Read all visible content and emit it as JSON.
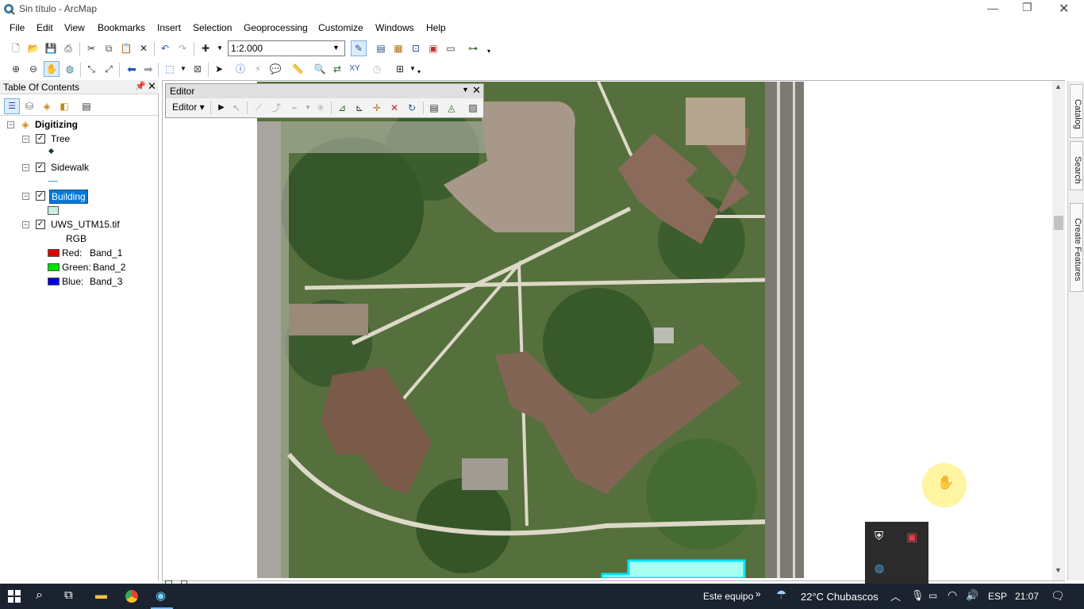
{
  "window": {
    "title": "Sin título - ArcMap"
  },
  "menu": [
    "File",
    "Edit",
    "View",
    "Bookmarks",
    "Insert",
    "Selection",
    "Geoprocessing",
    "Customize",
    "Windows",
    "Help"
  ],
  "toolbar": {
    "scale": "1:2.000"
  },
  "toc": {
    "title": "Table Of Contents",
    "group": "Digitizing",
    "layers": [
      {
        "name": "Tree",
        "checked": true
      },
      {
        "name": "Sidewalk",
        "checked": true
      },
      {
        "name": "Building",
        "checked": true,
        "selected": true
      },
      {
        "name": "UWS_UTM15.tif",
        "checked": true
      }
    ],
    "raster_composite": "RGB",
    "bands": [
      {
        "channel": "Red:",
        "band": "Band_1",
        "color": "#e00000"
      },
      {
        "channel": "Green:",
        "band": "Band_2",
        "color": "#00e000"
      },
      {
        "channel": "Blue:",
        "band": "Band_3",
        "color": "#0000e0"
      }
    ],
    "building_fill": "#c8f0e6"
  },
  "editor": {
    "title": "Editor",
    "menu_label": "Editor ▾"
  },
  "dock": {
    "catalog": "Catalog",
    "search": "Search",
    "create_features": "Create Features"
  },
  "taskbar": {
    "location": "Este equipo",
    "weather": "22°C  Chubascos",
    "lang": "ESP",
    "time": "21:07"
  },
  "colors": {
    "selection": "#0078d7",
    "polygon": "#a6fff0",
    "polygon_edge": "#00e5ff"
  }
}
